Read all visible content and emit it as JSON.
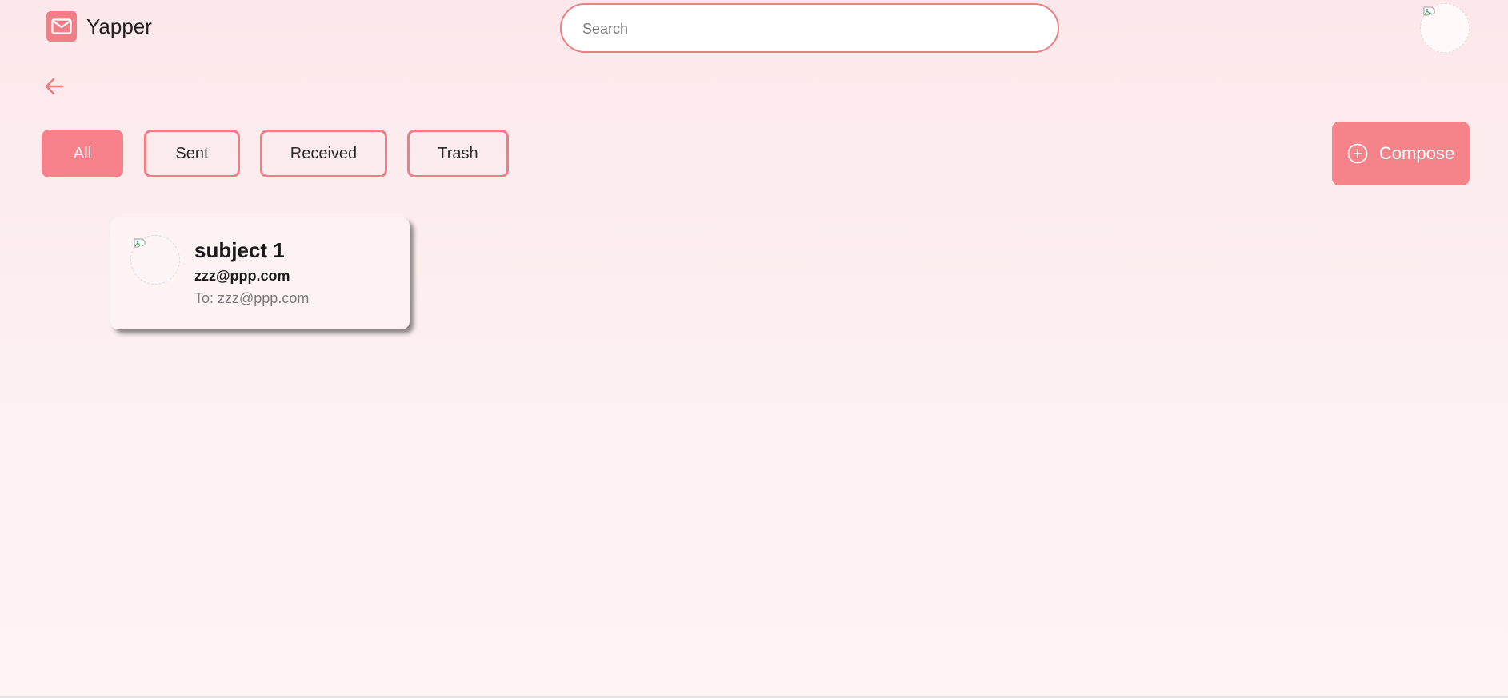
{
  "app": {
    "title": "Yapper",
    "logo_icon": "mail-icon",
    "accent_color": "#f4838a"
  },
  "search": {
    "placeholder": "Search",
    "value": ""
  },
  "header": {
    "avatar_icon": "broken-image-icon",
    "back_icon": "arrow-left-icon"
  },
  "tabs": [
    {
      "label": "All",
      "active": true
    },
    {
      "label": "Sent",
      "active": false
    },
    {
      "label": "Received",
      "active": false
    },
    {
      "label": "Trash",
      "active": false
    }
  ],
  "compose": {
    "label": "Compose",
    "icon": "plus-circle-icon"
  },
  "emails": [
    {
      "subject": "subject 1",
      "from": "zzz@ppp.com",
      "to": "To: zzz@ppp.com",
      "avatar_icon": "broken-image-icon"
    }
  ]
}
